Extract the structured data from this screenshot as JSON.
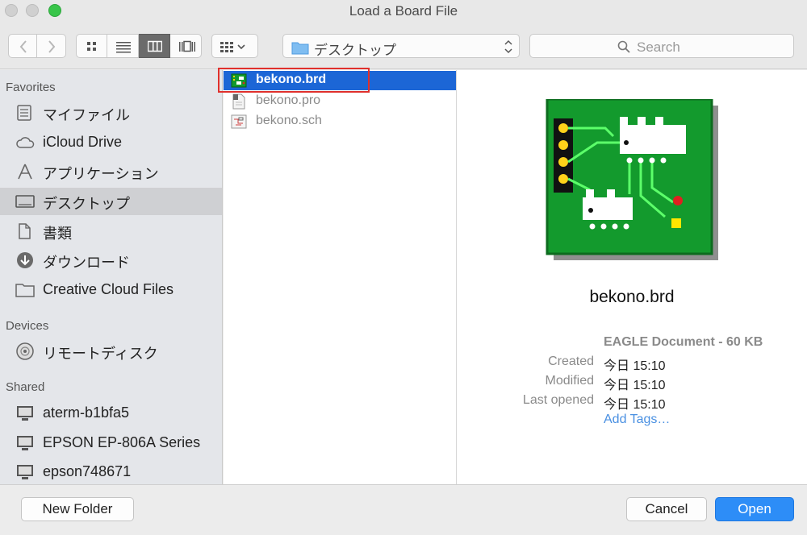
{
  "window": {
    "title": "Load a Board File"
  },
  "toolbar": {
    "location_label": "デスクトップ",
    "search_placeholder": "Search",
    "active_view": "columns"
  },
  "sidebar": {
    "favorites_heading": "Favorites",
    "favorites": [
      {
        "label": "マイファイル",
        "icon": "my-files-icon"
      },
      {
        "label": "iCloud Drive",
        "icon": "cloud-icon"
      },
      {
        "label": "アプリケーション",
        "icon": "applications-icon"
      },
      {
        "label": "デスクトップ",
        "icon": "desktop-icon",
        "selected": true
      },
      {
        "label": "書類",
        "icon": "documents-icon"
      },
      {
        "label": "ダウンロード",
        "icon": "downloads-icon"
      },
      {
        "label": "Creative Cloud Files",
        "icon": "folder-icon"
      }
    ],
    "devices_heading": "Devices",
    "devices": [
      {
        "label": "リモートディスク",
        "icon": "remote-disc-icon"
      }
    ],
    "shared_heading": "Shared",
    "shared": [
      {
        "label": "aterm-b1bfa5",
        "icon": "computer-icon"
      },
      {
        "label": "EPSON EP-806A Series",
        "icon": "computer-icon"
      },
      {
        "label": "epson748671",
        "icon": "computer-icon"
      }
    ]
  },
  "files": [
    {
      "name": "bekono.brd",
      "icon": "board-file-icon",
      "selected": true
    },
    {
      "name": "bekono.pro",
      "icon": "project-file-icon"
    },
    {
      "name": "bekono.sch",
      "icon": "schematic-file-icon"
    }
  ],
  "preview": {
    "name": "bekono.brd",
    "kind": "EAGLE Document - 60 KB",
    "created_label": "Created",
    "created_value": "今日 15:10",
    "modified_label": "Modified",
    "modified_value": "今日 15:10",
    "opened_label": "Last opened",
    "opened_value": "今日 15:10",
    "add_tags": "Add Tags…"
  },
  "buttons": {
    "new_folder": "New Folder",
    "cancel": "Cancel",
    "open": "Open"
  },
  "colors": {
    "selection_blue": "#1c66d6",
    "primary_button": "#2d8df7",
    "highlight_outline": "#e0302c",
    "board_green": "#139a2d"
  }
}
